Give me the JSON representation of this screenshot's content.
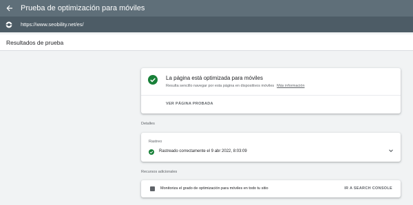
{
  "header": {
    "title": "Prueba de optimización para móviles",
    "back_icon": "arrow-left-icon"
  },
  "url_bar": {
    "url": "https://www.seobility.net/es/",
    "icon": "globe-icon"
  },
  "results": {
    "title": "Resultados de prueba"
  },
  "main_card": {
    "title": "La página está optimizada para móviles",
    "subtitle": "Resulta sencillo navegar por esta página en dispositivos móviles",
    "more_info": "Más información",
    "view_button": "VER PÁGINA PROBADA",
    "status_color": "#188038"
  },
  "details": {
    "label": "Detalles",
    "card_label": "Rastreo",
    "tracked_text": "Rastreado correctamente el 9 abr 2022, 8:03:09"
  },
  "additional": {
    "label": "Recursos adicionales",
    "resource_text": "Monitoriza el grado de optimización para móviles en todo tu sitio",
    "console_link": "IR A SEARCH CONSOLE"
  }
}
